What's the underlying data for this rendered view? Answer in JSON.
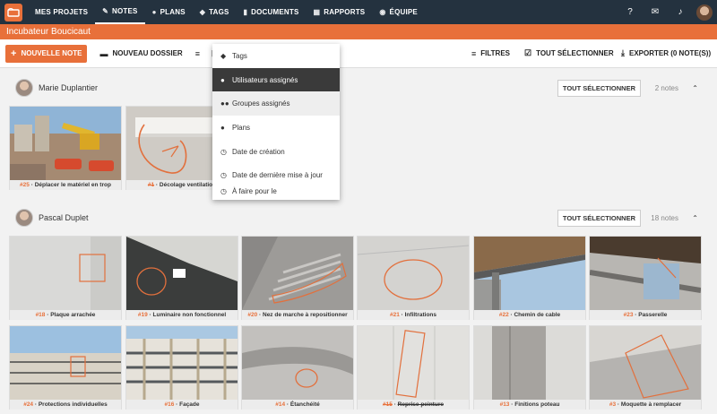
{
  "nav": {
    "items": [
      {
        "label": "MES PROJETS",
        "icon": "",
        "active": false
      },
      {
        "label": "NOTES",
        "icon": "✎",
        "active": true
      },
      {
        "label": "PLANS",
        "icon": "●",
        "active": false
      },
      {
        "label": "TAGS",
        "icon": "◆",
        "active": false
      },
      {
        "label": "DOCUMENTS",
        "icon": "▮",
        "active": false
      },
      {
        "label": "RAPPORTS",
        "icon": "▦",
        "active": false
      },
      {
        "label": "ÉQUIPE",
        "icon": "◉",
        "active": false
      }
    ]
  },
  "title": "Incubateur Boucicaut",
  "toolbar": {
    "new_note": "NOUVELLE NOTE",
    "new_folder": "NOUVEAU DOSSIER",
    "filters": "FILTRES",
    "select_all": "TOUT SÉLECTIONNER",
    "export": "EXPORTER (0 NOTE(S))"
  },
  "dropdown": {
    "items": [
      "Tags",
      "Utilisateurs assignés",
      "Groupes assignés",
      "Plans",
      "Date de création",
      "Date de dernière mise à jour",
      "À faire pour le"
    ]
  },
  "sections": [
    {
      "name": "Marie Duplantier",
      "select": "TOUT SÉLECTIONNER",
      "count": "2 notes",
      "notes": [
        {
          "num": "#25",
          "title": "Déplacer le matériel en trop",
          "strike": false
        },
        {
          "num": "#1",
          "title": "Décolage ventilation",
          "strike": true
        }
      ]
    },
    {
      "name": "Pascal Duplet",
      "select": "TOUT SÉLECTIONNER",
      "count": "18 notes",
      "notes": [
        {
          "num": "#18",
          "title": "Plaque arrachée",
          "strike": false
        },
        {
          "num": "#19",
          "title": "Luminaire non fonctionnel",
          "strike": false
        },
        {
          "num": "#20",
          "title": "Nez de marche à repositionner",
          "strike": false
        },
        {
          "num": "#21",
          "title": "Infiltrations",
          "strike": false
        },
        {
          "num": "#22",
          "title": "Chemin de cable",
          "strike": false
        },
        {
          "num": "#23",
          "title": "Passerelle",
          "strike": false
        },
        {
          "num": "#24",
          "title": "Protections individuelles",
          "strike": false
        },
        {
          "num": "#16",
          "title": "Façade",
          "strike": false
        },
        {
          "num": "#14",
          "title": "Étanchéité",
          "strike": false
        },
        {
          "num": "#15",
          "title": "Reprise peinture",
          "strike": true
        },
        {
          "num": "#13",
          "title": "Finitions poteau",
          "strike": false
        },
        {
          "num": "#3",
          "title": "Moquette à remplacer",
          "strike": false
        }
      ]
    }
  ]
}
